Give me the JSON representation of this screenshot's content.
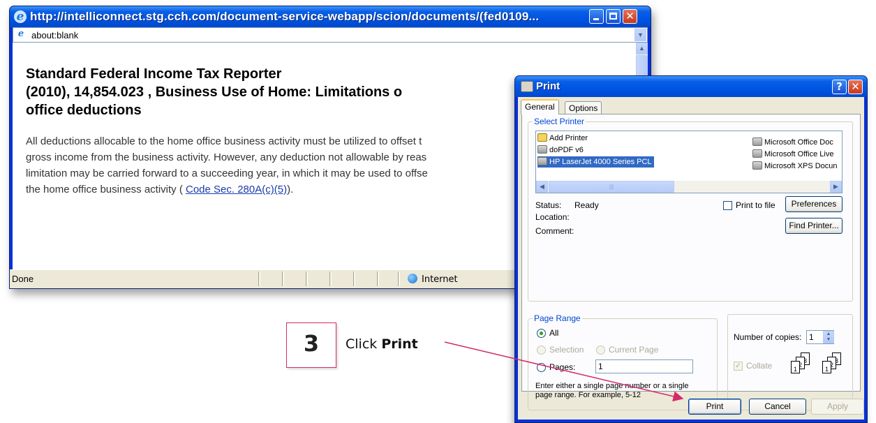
{
  "browser": {
    "title": "http://intelliconnect.stg.cch.com/document-service-webapp/scion/documents/(fed0109...",
    "address": "about:blank",
    "doc_title_lines": [
      "Standard Federal Income Tax Reporter",
      "(2010), 14,854.023 , Business Use of Home: Limitations o",
      "office deductions"
    ],
    "body_lines": [
      "All deductions allocable to the home office business activity must be utilized to offset t",
      "gross income from the business activity. However, any deduction not allowable by reas",
      "limitation may be carried forward to a succeeding year, in which it may be used to offse"
    ],
    "body_last_prefix": "the home office business activity ( ",
    "body_link": "Code Sec. 280A(c)(5)",
    "body_last_suffix": ").",
    "status_text": "Done",
    "zone_text": "Internet"
  },
  "print_dialog": {
    "title": "Print",
    "tabs": [
      "General",
      "Options"
    ],
    "select_printer_label": "Select Printer",
    "printers_left": [
      "Add Printer",
      "doPDF v6",
      "HP LaserJet 4000 Series PCL"
    ],
    "printers_right": [
      "Microsoft Office Doc",
      "Microsoft Office Live",
      "Microsoft XPS Docun"
    ],
    "status_label": "Status:",
    "status_value": "Ready",
    "location_label": "Location:",
    "comment_label": "Comment:",
    "print_to_file": "Print to file",
    "preferences": "Preferences",
    "find_printer": "Find Printer...",
    "page_range_label": "Page Range",
    "all": "All",
    "selection": "Selection",
    "current_page": "Current Page",
    "pages": "Pages:",
    "pages_value": "1",
    "hint_line1": "Enter either a single page number or a single",
    "hint_line2": "page range.  For example, 5-12",
    "copies_label": "Number of copies:",
    "copies_value": "1",
    "collate": "Collate",
    "print_btn": "Print",
    "cancel_btn": "Cancel",
    "apply_btn": "Apply",
    "collate_pages": [
      "1",
      "2",
      "3",
      "1",
      "2",
      "3"
    ]
  },
  "callout": {
    "step": "3",
    "text_prefix": "Click ",
    "text_bold": "Print",
    "color": "#d42a6c"
  },
  "icons": [
    "ie-icon",
    "printer-icon",
    "globe-icon",
    "help-icon",
    "close-icon"
  ]
}
